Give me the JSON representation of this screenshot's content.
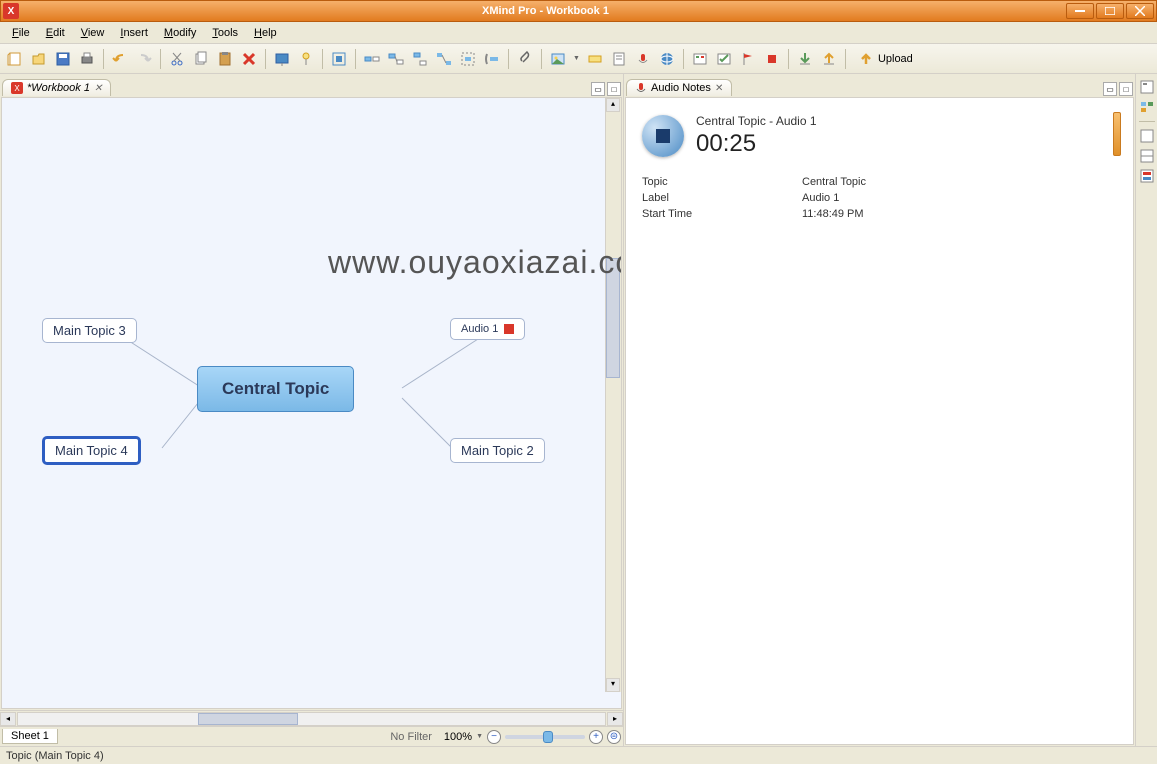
{
  "window": {
    "title": "XMind Pro - Workbook 1"
  },
  "menu": {
    "file": "File",
    "edit": "Edit",
    "view": "View",
    "insert": "Insert",
    "modify": "Modify",
    "tools": "Tools",
    "help": "Help"
  },
  "toolbar": {
    "upload_label": "Upload"
  },
  "workbook_tab": {
    "label": "*Workbook 1"
  },
  "mindmap": {
    "central": "Central Topic",
    "topic3": "Main Topic 3",
    "topic4": "Main Topic 4",
    "topic2": "Main Topic 2",
    "audio1": "Audio 1"
  },
  "sheet": {
    "label": "Sheet 1",
    "filter": "No Filter",
    "zoom": "100%"
  },
  "audio_panel": {
    "tab": "Audio Notes",
    "title": "Central Topic - Audio 1",
    "time": "00:25",
    "topic_label": "Topic",
    "topic_value": "Central Topic",
    "label_label": "Label",
    "label_value": "Audio 1",
    "start_label": "Start Time",
    "start_value": "11:48:49 PM"
  },
  "status": {
    "text": "Topic (Main Topic 4)"
  },
  "watermark": "www.ouyaoxiazai.com"
}
